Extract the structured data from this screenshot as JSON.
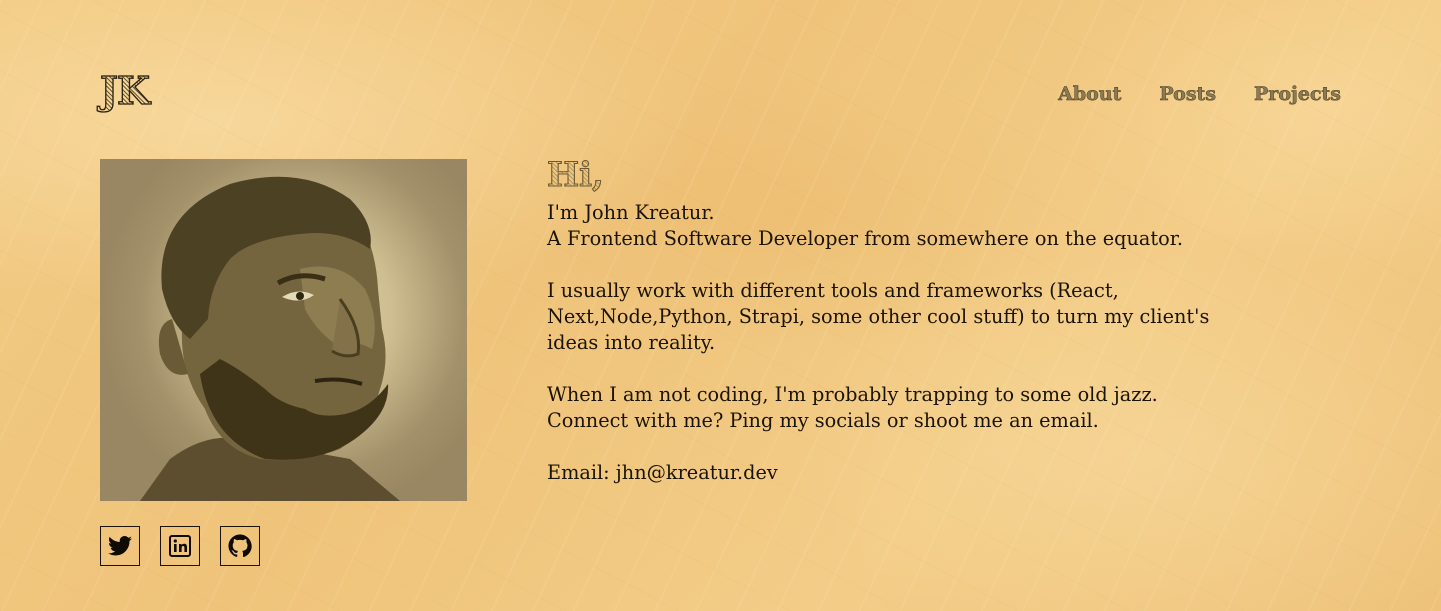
{
  "header": {
    "logo": "JK",
    "nav": [
      {
        "label": "About"
      },
      {
        "label": "Posts"
      },
      {
        "label": "Projects"
      }
    ]
  },
  "hero": {
    "greeting": "Hi,",
    "intro_line1": "I'm John Kreatur.",
    "intro_line2": "A Frontend Software Developer from somewhere on the equator.",
    "tools_line1": "I usually work with different tools and frameworks (React,",
    "tools_line2": "Next,Node,Python, Strapi, some other cool stuff) to turn my client's",
    "tools_line3": "ideas into reality.",
    "hobby_line": "When I am not coding, I'm probably trapping to some old jazz.",
    "connect_line": "Connect with me? Ping my socials or shoot me an email.",
    "email_line": "Email: jhn@kreatur.dev"
  },
  "socials": [
    {
      "icon": "twitter-icon"
    },
    {
      "icon": "linkedin-icon"
    },
    {
      "icon": "github-icon"
    }
  ],
  "colors": {
    "background": "#f1c97f",
    "text": "#1b1305",
    "nav": "#8a7a55",
    "portrait_tone": "#a3916a"
  }
}
